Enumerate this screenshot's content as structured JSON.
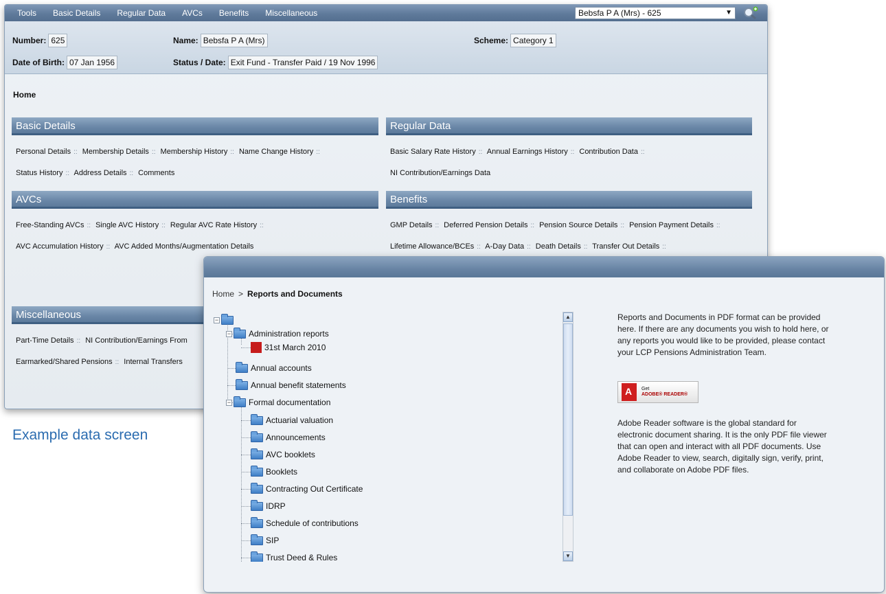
{
  "menu": [
    "Tools",
    "Basic Details",
    "Regular Data",
    "AVCs",
    "Benefits",
    "Miscellaneous"
  ],
  "member_select": "Bebsfa P A (Mrs) - 625",
  "member": {
    "number_label": "Number:",
    "number": "625",
    "name_label": "Name:",
    "name": "Bebsfa P A (Mrs)",
    "scheme_label": "Scheme:",
    "scheme": "Category 1",
    "dob_label": "Date of Birth:",
    "dob": "07 Jan 1956",
    "status_label": "Status / Date:",
    "status": "Exit Fund - Transfer Paid / 19 Nov 1996"
  },
  "page_title": "Home",
  "sections": {
    "basic": {
      "title": "Basic Details",
      "links": [
        "Personal Details",
        "Membership Details",
        "Membership History",
        "Name Change History",
        "Status History",
        "Address Details",
        "Comments"
      ]
    },
    "regular": {
      "title": "Regular Data",
      "links": [
        "Basic Salary Rate History",
        "Annual Earnings History",
        "Contribution Data",
        "NI Contribution/Earnings Data"
      ]
    },
    "avcs": {
      "title": "AVCs",
      "links": [
        "Free-Standing AVCs",
        "Single AVC History",
        "Regular AVC Rate History",
        "AVC Accumulation History",
        "AVC Added Months/Augmentation Details"
      ]
    },
    "benefits": {
      "title": "Benefits",
      "links": [
        "GMP Details",
        "Deferred Pension Details",
        "Pension Source Details",
        "Pension Payment Details",
        "Lifetime Allowance/BCEs",
        "A-Day Data",
        "Death Details",
        "Transfer Out Details"
      ]
    },
    "misc": {
      "title": "Miscellaneous",
      "links": [
        "Part-Time Details",
        "NI Contribution/Earnings From",
        "Earmarked/Shared Pensions",
        "Internal Transfers"
      ]
    }
  },
  "separator": "::",
  "breadcrumb": {
    "home": "Home",
    "sep": ">",
    "current": "Reports and Documents"
  },
  "tree": {
    "admin_reports": "Administration reports",
    "admin_child": "31st March 2010",
    "annual_accounts": "Annual accounts",
    "annual_benefit": "Annual benefit statements",
    "formal_docs": "Formal documentation",
    "formal_children": [
      "Actuarial valuation",
      "Announcements",
      "AVC booklets",
      "Booklets",
      "Contracting Out Certificate",
      "IDRP",
      "Schedule of contributions",
      "SIP",
      "Trust Deed & Rules"
    ]
  },
  "info_text": "Reports and Documents in PDF format can be provided here. If there are any documents you wish to hold here, or any reports you would like to be provided, please contact your LCP Pensions Administration Team.",
  "adobe": {
    "get": "Get",
    "reader": "ADOBE® READER®"
  },
  "info_text2": "Adobe Reader software is the global standard for electronic document sharing. It is the only PDF file viewer that can open and interact with all PDF documents. Use Adobe Reader to view, search, digitally sign, verify, print, and collaborate on Adobe PDF files.",
  "caption": "Example data screen",
  "icons": [
    "search-person-icon",
    "dropdown-arrow-icon",
    "folder-icon",
    "pdf-icon",
    "expand-icon",
    "collapse-icon",
    "scroll-up-icon",
    "scroll-down-icon",
    "adobe-logo-icon"
  ]
}
